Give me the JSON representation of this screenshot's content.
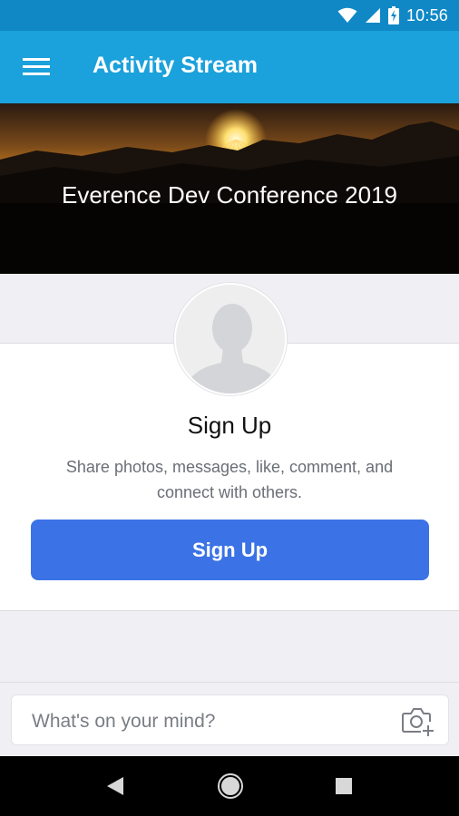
{
  "status_bar": {
    "time": "10:56",
    "icons": [
      "wifi-icon",
      "cell-signal-icon",
      "battery-charging-icon"
    ]
  },
  "app_bar": {
    "menu_icon": "hamburger-menu-icon",
    "title": "Activity Stream"
  },
  "banner": {
    "title": "Everence Dev Conference 2019",
    "image": "sunset-over-mountains"
  },
  "signup_card": {
    "avatar_icon": "default-user-avatar-icon",
    "heading": "Sign Up",
    "description": "Share photos, messages, like, comment, and connect with others.",
    "button_label": "Sign Up"
  },
  "composer": {
    "placeholder": "What's on your mind?",
    "camera_icon": "camera-add-icon"
  },
  "nav_bar": {
    "icons": [
      "back-icon",
      "home-icon",
      "recents-icon"
    ]
  },
  "colors": {
    "status_bar": "#1088c6",
    "app_bar": "#1ba1db",
    "button": "#3b73e6",
    "background": "#efeff4"
  }
}
